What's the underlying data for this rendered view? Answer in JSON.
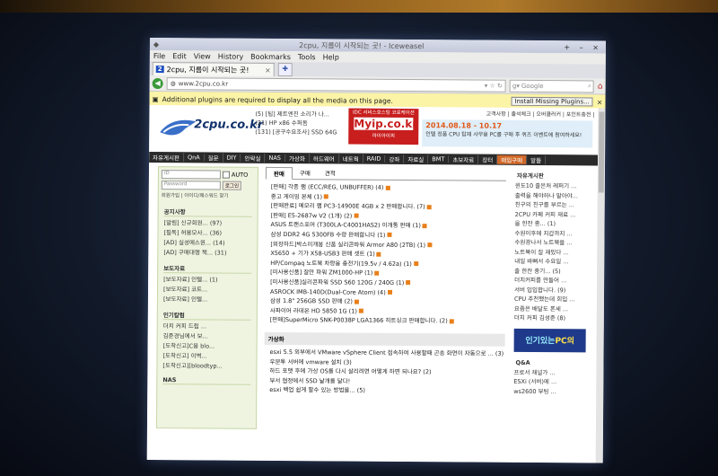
{
  "window": {
    "title": "2cpu, 지름이 시작되는 곳! - Iceweasel",
    "controls": "+ – ×"
  },
  "menu": [
    "File",
    "Edit",
    "View",
    "History",
    "Bookmarks",
    "Tools",
    "Help"
  ],
  "tab": {
    "favicon": "2",
    "label": "2cpu, 지름이 시작되는 곳!",
    "close": "×"
  },
  "newtab": "✚",
  "nav": {
    "url": "www.2cpu.co.kr",
    "search_placeholder": "Google"
  },
  "plugin": {
    "message": "Additional plugins are required to display all the media on this page.",
    "button": "Install Missing Plugins...",
    "close": "×"
  },
  "site": {
    "logo": "2cpu.co.kr",
    "news": [
      "(5) [팁] 제트엔진 소리가 나...",
      "(21) HP x86 수퍼돔",
      "(131) [공구수요조사] SSD 64G"
    ],
    "ad1": {
      "top": "IDC 서비스호스팅 코로케이션",
      "brand": "Myip.co.kr",
      "sub": "마이아이피"
    },
    "ad2": {
      "date": "2014.08.18 - 10.17",
      "text": "인텔 정품 CPU 탑재 사무용 PC를 구매 후 퀴즈 이벤트에 참여하세요!"
    },
    "toplinks": "고객사항 | 출석체크 | 오버클러커 | 포인트충전 |",
    "navstrip": [
      "자유게시판",
      "QnA",
      "질문",
      "DIY",
      "안락실",
      "NAS",
      "가상화",
      "하드웨어",
      "네트웍",
      "RAID",
      "강좌",
      "자료실",
      "BMT",
      "초보자료",
      "장터",
      "매입구매",
      "알뜰"
    ],
    "login": {
      "id": "ID",
      "pw": "Password",
      "auto": "AUTO",
      "btn": "로그인",
      "links": "회원가입 | 아이디/패스워드 찾기"
    },
    "left_sections": [
      {
        "title": "공지사항",
        "items": [
          "[알림] 신규회원... (97)",
          "[필독] 허용모사... (36)",
          "[AD] 실성에스원... (14)",
          "[AD] 구매대행 책... (31)"
        ]
      },
      {
        "title": "보도자료",
        "items": [
          "[보도자료] 인텔... (1)",
          "[보도자료] 코트...",
          "[보도자료] 인텔..."
        ]
      },
      {
        "title": "인기칼럼",
        "items": [
          "더치 커피 드립 ...",
          "김준경님에서 보...",
          "[도착신고]C용 blo...",
          "[도착신고] 이벽...",
          "[도착신고][bloodtyp..."
        ]
      },
      {
        "title": "NAS",
        "items": []
      }
    ],
    "main_tabs": [
      "판매",
      "구매",
      "견적"
    ],
    "main_items": [
      "[판매] 각종 램 (ECC/REG, UNBUFFER) (4)",
      "중고 게이밍 본체 (1)",
      "[판매완료] 메모리 램 PC3-14900E 4GB x 2 판매합니다. (7)",
      "[판매] E5-2687w V2 (1개) (2)",
      "ASUS 트랜스포머 (T300LA-C4001HAS2) 이개통 판매 (1)",
      "삼성 DDR2 4G 5300FB 수량 판매합니다 (1)",
      "[외장하드]박스미개봉 신품 실리콘파워 Armor A80 (2TB) (1)",
      "X5650 + 기가 X58-USB3 판매 셋트 (1)",
      "HP/Compaq 노트북 차량용 충전기(19.5v / 4.62a) (1)",
      "[미사용신품] 잘만 파워 ZM1000-HP (1)",
      "[미사용신품]실리콘파워 SSD S60 120G / 240G (1)",
      "ASROCK IMB-140D(Dual-Core Atom) (4)",
      "삼성 1.8\" 256GB SSD 판매 (2)",
      "사파이어 라데온 HD 5850 1G (1)",
      "[판매]SuperMicro SNK-P0038P LGA1366 히트싱크 판매합니다. (2)"
    ],
    "virt_title": "가상화",
    "virt_items": [
      "esxi 5.5 외부에서 VMware vSphere Client 접속하여 사용할때 곤송 화면이 자동으로 ... (3)",
      "우분투 서버에 vmware 설치 (3)",
      "하드 포맷 후에 가상 OS를 다시 살리려면 어떻게 하면 되나요? (2)",
      "부서 협정에서 SSD 날개를 달다!",
      "esxi 백업 쉽게 할수 있는 방법을... (5)"
    ],
    "right_sections": [
      {
        "title": "자유게시판",
        "items": [
          "윈도10 출은처 레퍼기 ...",
          "출력을 해야하나 말아야...",
          "친구의 친구를 부르는 ...",
          "2CPU 카페 커피 재료 ...",
          "을 한잔 중... (1)",
          "수원이후에 지갑까지 ...",
          "수원광나서 노트북을 ...",
          "노트북이 잘 재밌다 ...",
          "내일 바뻐서 수요일 ...",
          "출 한잔 중기... (5)",
          "더치커피를 만들어 ...",
          "서버 입입합니다. (9)",
          "CPU 추천했는데 회입 ...",
          "요즘은 배달도 폰세 ...",
          "더치 커피 김성준 (8)"
        ]
      },
      {
        "title": "Q&A",
        "items": [
          "프로서 채널가 ...",
          "ESXi (서버)에 ...",
          "ws2600 부팅 ..."
        ]
      }
    ],
    "right_ad": {
      "pre": "인기있는 ",
      "em": "PC의"
    }
  },
  "colors": {
    "accent": "#d06828",
    "brand": "#10306a",
    "plugin_bar": "#fbf4a6"
  }
}
